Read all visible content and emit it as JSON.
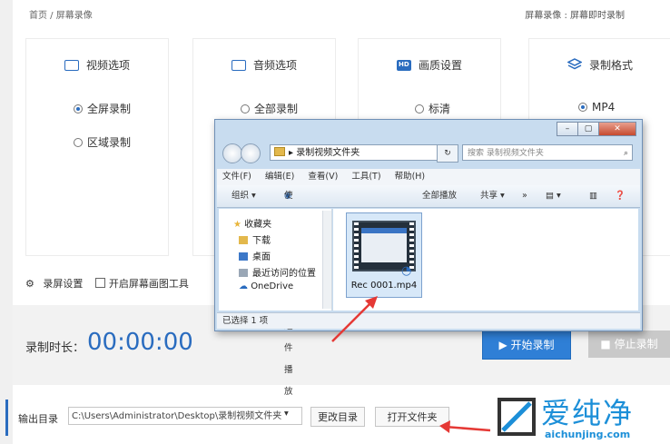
{
  "header": {
    "breadcrumb": "首页 / 屏幕录像",
    "right_status": "屏幕录像 : 屏幕即时录制"
  },
  "panels": [
    {
      "title": "视频选项",
      "icon": "video-play-icon",
      "options": [
        "全屏录制",
        "区域录制"
      ],
      "selected": "全屏录制"
    },
    {
      "title": "音频选项",
      "icon": "audio-wave-icon",
      "options": [
        "全部录制"
      ],
      "selected": null
    },
    {
      "title": "画质设置",
      "icon": "hd-icon",
      "options": [
        "标清"
      ],
      "selected": null
    },
    {
      "title": "录制格式",
      "icon": "layers-icon",
      "options": [
        "MP4"
      ],
      "selected": "MP4"
    }
  ],
  "settings": {
    "label": "录屏设置",
    "checkbox1": "开启屏幕画图工具"
  },
  "recording": {
    "duration_label": "录制时长：",
    "duration": "00:00:00",
    "start": "开始录制",
    "stop": "停止录制"
  },
  "output": {
    "label": "输出目录",
    "path": "C:\\Users\\Administrator\\Desktop\\录制视频文件夹",
    "change_dir": "更改目录",
    "open_folder": "打开文件夹"
  },
  "explorer": {
    "address": "录制视频文件夹",
    "search_placeholder": "搜索 录制视频文件夹",
    "menu": [
      "文件(F)",
      "编辑(E)",
      "查看(V)",
      "工具(T)",
      "帮助(H)"
    ],
    "toolbar": {
      "organize": "组织 ▾",
      "play_with": "使用 迅雷播放组件 播放 ▾",
      "play_all": "全部播放",
      "share": "共享 ▾",
      "more": "»"
    },
    "nav": {
      "favorites": "收藏夹",
      "items": [
        "下载",
        "桌面",
        "最近访问的位置",
        "OneDrive"
      ]
    },
    "file_name": "Rec 0001.mp4",
    "status": "已选择 1 项"
  },
  "watermark": {
    "text": "爱纯净",
    "url": "aichunjing.com"
  },
  "colors": {
    "accent": "#2a6cbf",
    "start_button": "#2f7fd6",
    "arrow": "#e53935"
  }
}
